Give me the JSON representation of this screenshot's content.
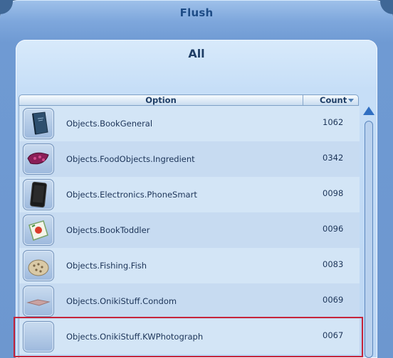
{
  "window": {
    "title": "Flush"
  },
  "panel": {
    "subtitle": "All"
  },
  "table": {
    "columns": {
      "option": "Option",
      "count": "Count"
    },
    "rows": [
      {
        "option": "Objects.BookGeneral",
        "count": "1062",
        "icon": "book-icon"
      },
      {
        "option": "Objects.FoodObjects.Ingredient",
        "count": "0342",
        "icon": "ingredient-icon"
      },
      {
        "option": "Objects.Electronics.PhoneSmart",
        "count": "0098",
        "icon": "smartphone-icon"
      },
      {
        "option": "Objects.BookToddler",
        "count": "0096",
        "icon": "toddler-book-icon"
      },
      {
        "option": "Objects.Fishing.Fish",
        "count": "0083",
        "icon": "fish-icon"
      },
      {
        "option": "Objects.OnikiStuff.Condom",
        "count": "0069",
        "icon": "condom-icon"
      },
      {
        "option": "Objects.OnikiStuff.KWPhotograph",
        "count": "0067",
        "icon": "blank-thumbnail-icon"
      }
    ]
  },
  "colors": {
    "highlight": "#c6243a",
    "title": "#1e4c86",
    "scroll_arrow": "#2f6ec2"
  }
}
